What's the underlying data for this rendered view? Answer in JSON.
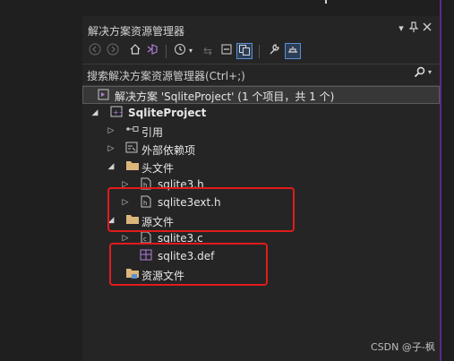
{
  "window": {
    "title": "解决方案资源管理器",
    "title_icons": [
      "chevron-down-icon",
      "pin-icon",
      "close-icon"
    ]
  },
  "toolbar": {
    "tools": [
      "back-icon",
      "forward-icon",
      "home-icon",
      "vs-switch-icon",
      "history-icon",
      "sync-icon",
      "collapse-all-icon",
      "show-all-files-icon",
      "properties-icon",
      "preview-icon"
    ]
  },
  "search": {
    "placeholder": "搜索解决方案资源管理器(Ctrl+;)"
  },
  "tree": {
    "solution_label": "解决方案 'SqliteProject' (1 个项目，共 1 个)",
    "project_label": "SqliteProject",
    "references_label": "引用",
    "external_deps_label": "外部依赖项",
    "header_files_label": "头文件",
    "header_files": [
      "sqlite3.h",
      "sqlite3ext.h"
    ],
    "source_files_label": "源文件",
    "source_files": [
      "sqlite3.c",
      "sqlite3.def"
    ],
    "resource_files_label": "资源文件"
  },
  "colors": {
    "accent": "#5a2c8a",
    "highlight_box": "#e21b1b",
    "folder": "#dcb67a"
  },
  "watermark": "CSDN @子-枫"
}
